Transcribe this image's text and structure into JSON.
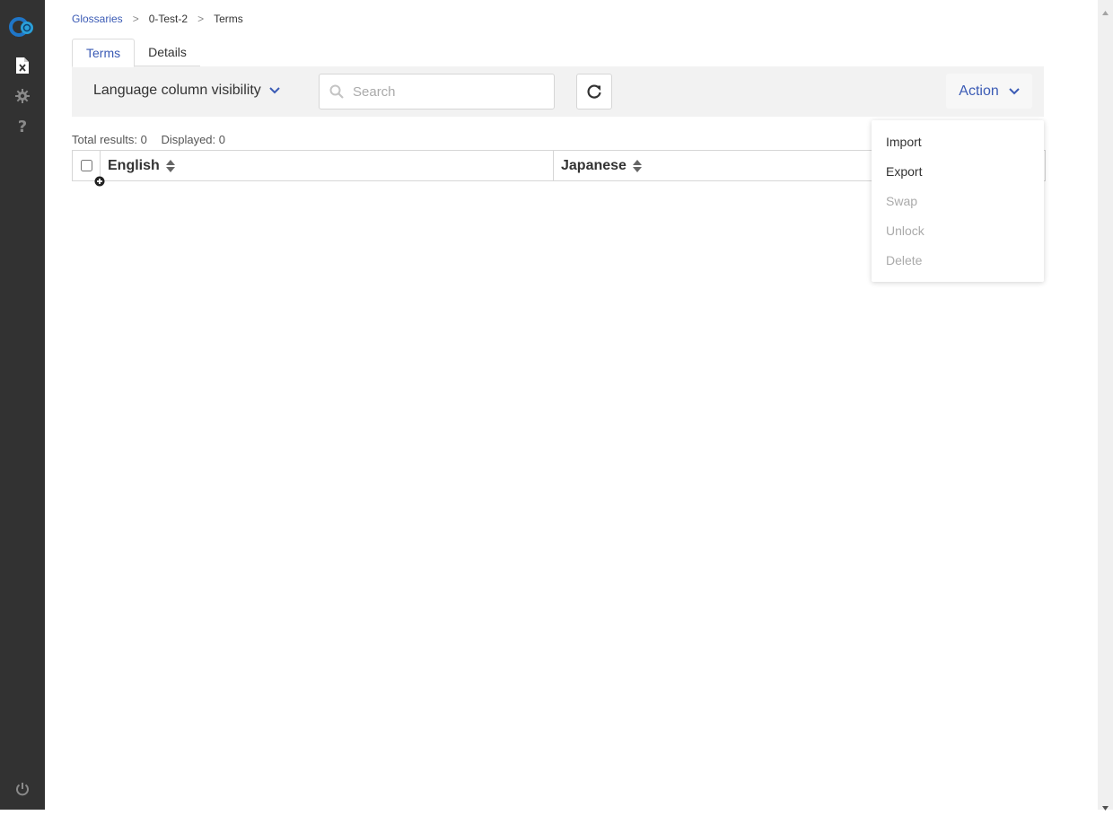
{
  "sidebar": {
    "items": [
      {
        "icon": "app-logo-icon"
      },
      {
        "icon": "glossary-file-icon"
      },
      {
        "icon": "gear-icon"
      },
      {
        "icon": "help-icon"
      },
      {
        "icon": "power-icon"
      }
    ]
  },
  "breadcrumb": {
    "items": [
      "Glossaries",
      "0-Test-2",
      "Terms"
    ],
    "separator": ">"
  },
  "tabs": [
    {
      "label": "Terms",
      "active": true
    },
    {
      "label": "Details",
      "active": false
    }
  ],
  "toolbar": {
    "language_visibility_label": "Language column visibility",
    "search_placeholder": "Search",
    "search_value": "",
    "action_label": "Action"
  },
  "results": {
    "total": "Total results: 0",
    "displayed": "Displayed: 0"
  },
  "table": {
    "columns": [
      "English",
      "Japanese"
    ],
    "rows": []
  },
  "action_menu": {
    "items": [
      {
        "label": "Import",
        "enabled": true
      },
      {
        "label": "Export",
        "enabled": true
      },
      {
        "label": "Swap",
        "enabled": false
      },
      {
        "label": "Unlock",
        "enabled": false
      },
      {
        "label": "Delete",
        "enabled": false
      }
    ]
  },
  "colors": {
    "accent": "#3b5bb5",
    "sidebar_bg": "#323232",
    "toolbar_bg": "#f2f2f2",
    "disabled_text": "#aaaaaa"
  }
}
